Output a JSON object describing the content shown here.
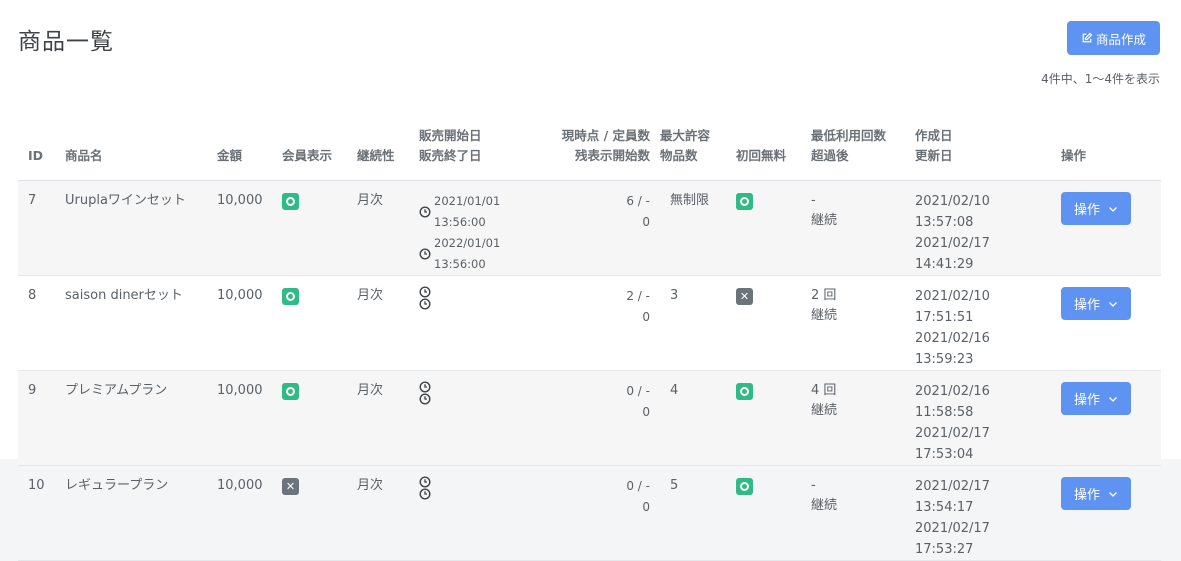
{
  "header": {
    "title": "商品一覧",
    "create_button": "商品作成",
    "count_text": "4件中、1〜4件を表示"
  },
  "table": {
    "headers": {
      "id": "ID",
      "name": "商品名",
      "price": "金額",
      "member_display": "会員表示",
      "continuity": "継続性",
      "sale_start": "販売開始日",
      "sale_end": "販売終了日",
      "current_capacity": "現時点 / 定員数",
      "remaining_display": "残表示開始数",
      "max_allowed": "最大許容",
      "product_count": "物品数",
      "first_free": "初回無料",
      "min_usage": "最低利用回数",
      "after_exceed": "超過後",
      "created": "作成日",
      "updated": "更新日",
      "actions": "操作"
    },
    "rows": [
      {
        "id": "7",
        "name": "Uruplaワインセット",
        "price": "10,000",
        "member_display": "ok",
        "continuity": "月次",
        "sale_start": "2021/01/01 13:56:00",
        "sale_end": "2022/01/01 13:56:00",
        "current_capacity": "6 / -",
        "remaining_display": "0",
        "max_allowed": "無制限",
        "first_free": "ok",
        "min_usage": "-",
        "after_exceed": "継続",
        "created": "2021/02/10 13:57:08",
        "updated": "2021/02/17 14:41:29",
        "action_label": "操作"
      },
      {
        "id": "8",
        "name": "saison dinerセット",
        "price": "10,000",
        "member_display": "ok",
        "continuity": "月次",
        "sale_start": "",
        "sale_end": "",
        "current_capacity": "2 / -",
        "remaining_display": "0",
        "max_allowed": "3",
        "first_free": "ng",
        "min_usage": "2 回",
        "after_exceed": "継続",
        "created": "2021/02/10 17:51:51",
        "updated": "2021/02/16 13:59:23",
        "action_label": "操作"
      },
      {
        "id": "9",
        "name": "プレミアムプラン",
        "price": "10,000",
        "member_display": "ok",
        "continuity": "月次",
        "sale_start": "",
        "sale_end": "",
        "current_capacity": "0 / -",
        "remaining_display": "0",
        "max_allowed": "4",
        "first_free": "ok",
        "min_usage": "4 回",
        "after_exceed": "継続",
        "created": "2021/02/16 11:58:58",
        "updated": "2021/02/17 17:53:04",
        "action_label": "操作"
      },
      {
        "id": "10",
        "name": "レギュラープラン",
        "price": "10,000",
        "member_display": "ng",
        "continuity": "月次",
        "sale_start": "",
        "sale_end": "",
        "current_capacity": "0 / -",
        "remaining_display": "0",
        "max_allowed": "5",
        "first_free": "ok",
        "min_usage": "-",
        "after_exceed": "継続",
        "created": "2021/02/17 13:54:17",
        "updated": "2021/02/17 17:53:27",
        "action_label": "操作"
      }
    ]
  },
  "icons": {
    "edit": "edit-icon",
    "clock": "clock-icon",
    "check": "circle-check-icon",
    "cross": "x-icon",
    "chevron": "chevron-down-icon"
  },
  "colors": {
    "primary": "#5f93f2",
    "success": "#2fba86",
    "muted": "#6c747b"
  }
}
